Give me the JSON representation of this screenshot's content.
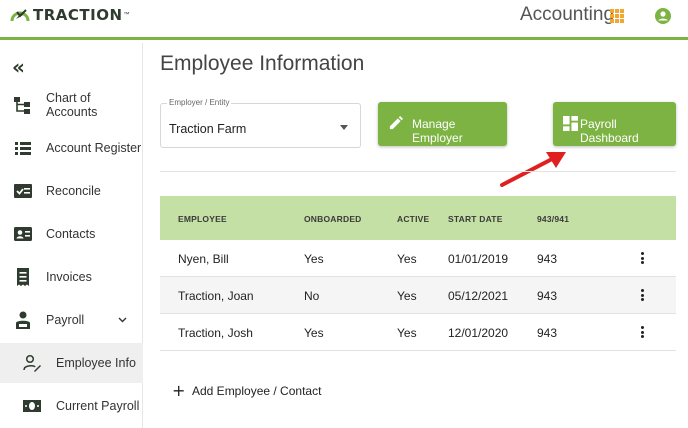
{
  "header": {
    "logo_text": "TRACTION",
    "logo_tm": "™",
    "module_title": "Accounting"
  },
  "sidebar": {
    "collapse_glyph": "«",
    "items": [
      {
        "label": "Chart of Accounts",
        "icon": "chart-of-accounts-icon"
      },
      {
        "label": "Account Register",
        "icon": "list-icon"
      },
      {
        "label": "Reconcile",
        "icon": "reconcile-icon"
      },
      {
        "label": "Contacts",
        "icon": "contacts-icon"
      },
      {
        "label": "Invoices",
        "icon": "invoice-icon"
      },
      {
        "label": "Payroll",
        "icon": "payroll-icon",
        "expanded": true
      },
      {
        "label": "Employee Info",
        "icon": "employee-edit-icon",
        "active": true
      },
      {
        "label": "Current Payroll",
        "icon": "money-icon"
      }
    ]
  },
  "page": {
    "title": "Employee Information"
  },
  "employer_select": {
    "label": "Employer / Entity",
    "value": "Traction Farm"
  },
  "buttons": {
    "manage_employer": "Manage Employer",
    "payroll_dashboard": "Payroll Dashboard"
  },
  "table": {
    "columns": [
      "EMPLOYEE",
      "ONBOARDED",
      "ACTIVE",
      "START DATE",
      "943/941"
    ],
    "rows": [
      {
        "employee": "Nyen, Bill",
        "onboarded": "Yes",
        "active": "Yes",
        "start_date": "01/01/2019",
        "form": "943"
      },
      {
        "employee": "Traction, Joan",
        "onboarded": "No",
        "active": "Yes",
        "start_date": "05/12/2021",
        "form": "943"
      },
      {
        "employee": "Traction, Josh",
        "onboarded": "Yes",
        "active": "Yes",
        "start_date": "12/01/2020",
        "form": "943"
      }
    ]
  },
  "add_contact": {
    "plus": "+",
    "label": "Add Employee / Contact"
  },
  "colors": {
    "brand_green": "#7cb342",
    "table_header": "#c5e0a5",
    "apps_orange": "#f0a830",
    "arrow_red": "#e02020"
  }
}
